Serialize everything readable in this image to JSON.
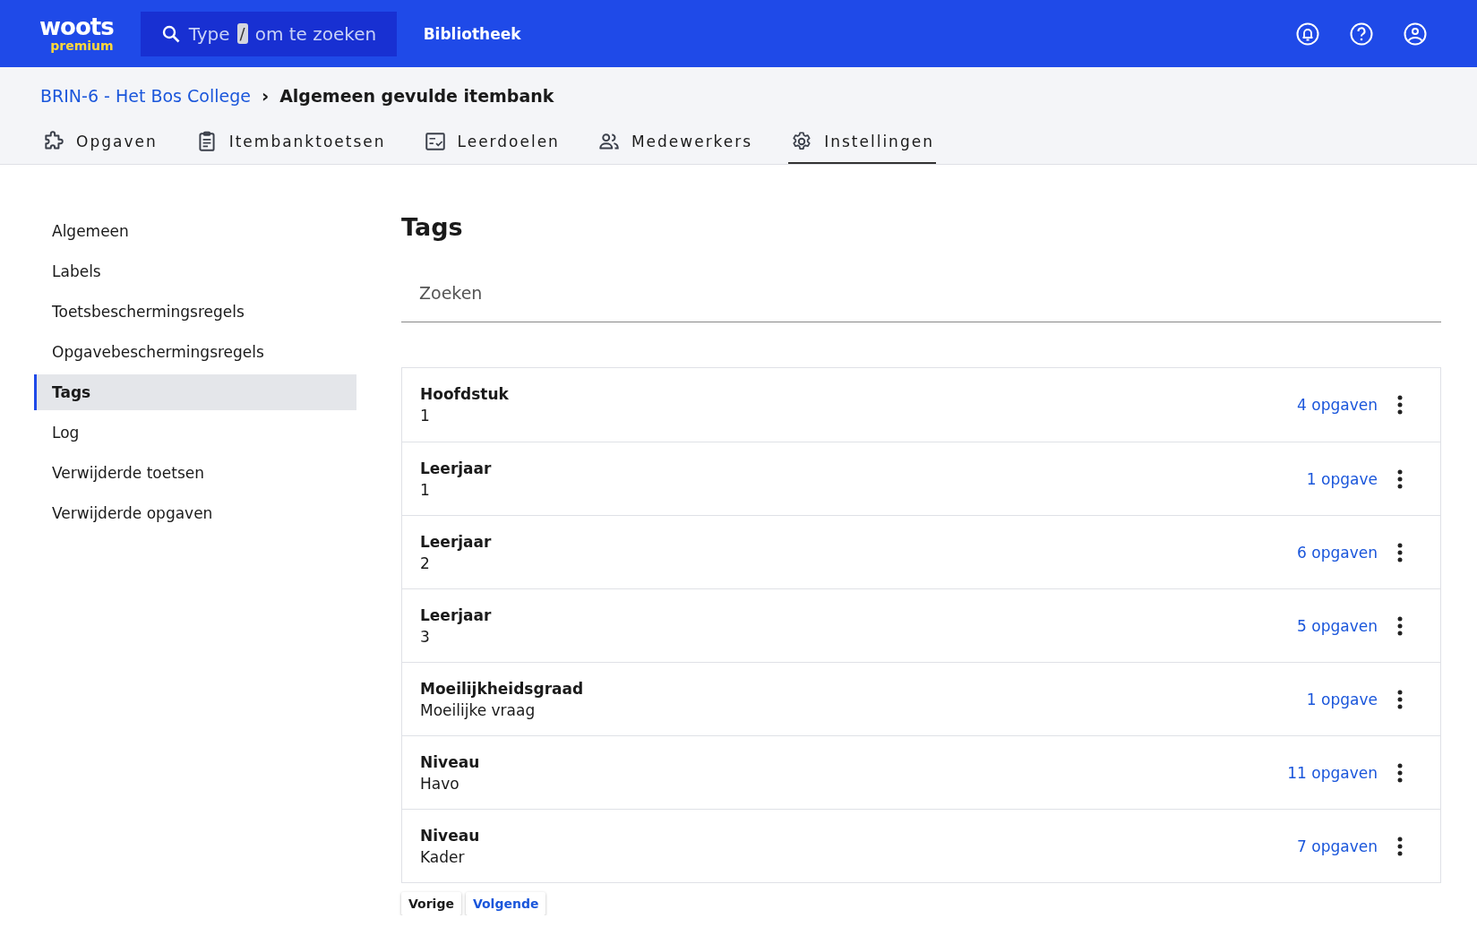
{
  "header": {
    "logo": {
      "brand": "woots",
      "tier": "premium"
    },
    "search": {
      "placeholder_before": "Type",
      "shortcut": "/",
      "placeholder_after": "om te zoeken"
    },
    "nav_link": "Bibliotheek"
  },
  "breadcrumb": {
    "parent": "BRIN-6 - Het Bos College",
    "separator": "›",
    "current": "Algemeen gevulde itembank"
  },
  "tabs": [
    {
      "label": "Opgaven",
      "kind": "puzzle",
      "selected": false
    },
    {
      "label": "Itembanktoetsen",
      "kind": "clipboard",
      "selected": false
    },
    {
      "label": "Leerdoelen",
      "kind": "checklist",
      "selected": false
    },
    {
      "label": "Medewerkers",
      "kind": "people",
      "selected": false
    },
    {
      "label": "Instellingen",
      "kind": "gear",
      "selected": true
    }
  ],
  "sidebar": {
    "items": [
      {
        "label": "Algemeen",
        "selected": false
      },
      {
        "label": "Labels",
        "selected": false
      },
      {
        "label": "Toetsbeschermingsregels",
        "selected": false
      },
      {
        "label": "Opgavebeschermingsregels",
        "selected": false
      },
      {
        "label": "Tags",
        "selected": true
      },
      {
        "label": "Log",
        "selected": false
      },
      {
        "label": "Verwijderde toetsen",
        "selected": false
      },
      {
        "label": "Verwijderde opgaven",
        "selected": false
      }
    ]
  },
  "main": {
    "title": "Tags",
    "search": {
      "placeholder": "Zoeken"
    },
    "tags": [
      {
        "name": "Hoofdstuk",
        "value": "1",
        "count": "4 opgaven"
      },
      {
        "name": "Leerjaar",
        "value": "1",
        "count": "1 opgave"
      },
      {
        "name": "Leerjaar",
        "value": "2",
        "count": "6 opgaven"
      },
      {
        "name": "Leerjaar",
        "value": "3",
        "count": "5 opgaven"
      },
      {
        "name": "Moeilijkheidsgraad",
        "value": "Moeilijke vraag",
        "count": "1 opgave"
      },
      {
        "name": "Niveau",
        "value": "Havo",
        "count": "11 opgaven"
      },
      {
        "name": "Niveau",
        "value": "Kader",
        "count": "7 opgaven"
      }
    ],
    "pagination": [
      {
        "label": "Vorige",
        "kind": "plain"
      },
      {
        "label": "Volgende",
        "kind": "link"
      }
    ]
  }
}
